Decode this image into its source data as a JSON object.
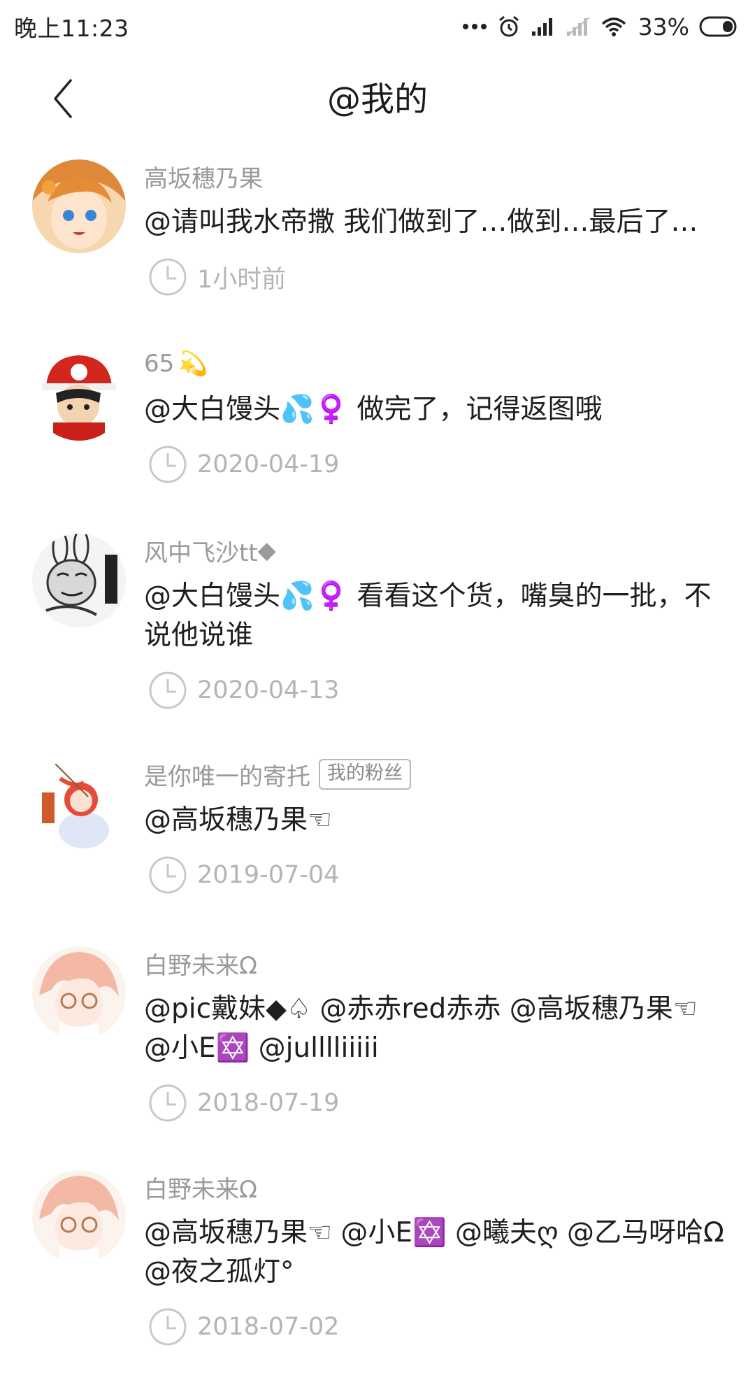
{
  "status_bar": {
    "time": "晚上11:23",
    "battery": "33%"
  },
  "header": {
    "title": "@我的"
  },
  "mentions": [
    {
      "username": "高坂穗乃果",
      "username_suffix": "",
      "badge": "",
      "message": "@请叫我水帝撒 我们做到了…做到…最后了…",
      "time": "1小时前"
    },
    {
      "username": "65",
      "username_suffix": "💫",
      "badge": "",
      "message": " @大白馒头💦♀️ 做完了，记得返图哦",
      "time": "2020-04-19"
    },
    {
      "username": "风中飞沙tt",
      "username_suffix": "◆",
      "badge": "",
      "message": "@大白馒头💦♀️ 看看这个货，嘴臭的一批，不说他说谁",
      "time": "2020-04-13"
    },
    {
      "username": "是你唯一的寄托",
      "username_suffix": "",
      "badge": "我的粉丝",
      "message": " @高坂穗乃果☜",
      "time": "2019-07-04"
    },
    {
      "username": "白野未来Ω",
      "username_suffix": "",
      "badge": "",
      "message": " @pic戴妹◆♤ @赤赤red赤赤 @高坂穗乃果☜ @小E✡️ @julllliiiii",
      "time": "2018-07-19"
    },
    {
      "username": "白野未来Ω",
      "username_suffix": "",
      "badge": "",
      "message": " @高坂穗乃果☜ @小E✡️ @曦夫ღ @乙马呀哈Ω @夜之孤灯°",
      "time": "2018-07-02"
    }
  ],
  "colors": {
    "username": "#9a9a9a",
    "time": "#b4b4b4",
    "text": "#1e1e1e"
  }
}
